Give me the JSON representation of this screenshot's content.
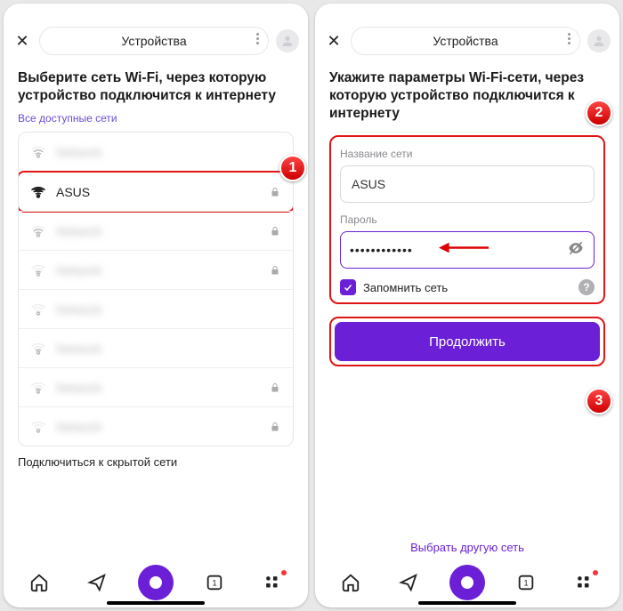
{
  "left": {
    "header_title": "Устройства",
    "heading": "Выберите сеть Wi-Fi, через которую устройство подключится к интернету",
    "subheading": "Все доступные сети",
    "networks": [
      {
        "name": "—",
        "blur": true,
        "lock": false,
        "strength": 3
      },
      {
        "name": "ASUS",
        "blur": false,
        "lock": true,
        "strength": 4,
        "selected": true
      },
      {
        "name": "—",
        "blur": true,
        "lock": true,
        "strength": 3
      },
      {
        "name": "—",
        "blur": true,
        "lock": true,
        "strength": 2
      },
      {
        "name": "—",
        "blur": true,
        "lock": false,
        "strength": 1
      },
      {
        "name": "—",
        "blur": true,
        "lock": false,
        "strength": 2
      },
      {
        "name": "—",
        "blur": true,
        "lock": true,
        "strength": 2
      },
      {
        "name": "—",
        "blur": true,
        "lock": true,
        "strength": 1
      }
    ],
    "hidden_network": "Подключиться к скрытой сети",
    "badge": "1"
  },
  "right": {
    "header_title": "Устройства",
    "heading": "Укажите параметры Wi-Fi-сети, через которую устройство подключится к интернету",
    "ssid_label": "Название сети",
    "ssid_value": "ASUS",
    "password_label": "Пароль",
    "password_value": "••••••••••••",
    "remember_label": "Запомнить сеть",
    "continue_label": "Продолжить",
    "alt_link": "Выбрать другую сеть",
    "help": "?",
    "badge2": "2",
    "badge3": "3"
  },
  "nav": {
    "tab_count": "1"
  }
}
